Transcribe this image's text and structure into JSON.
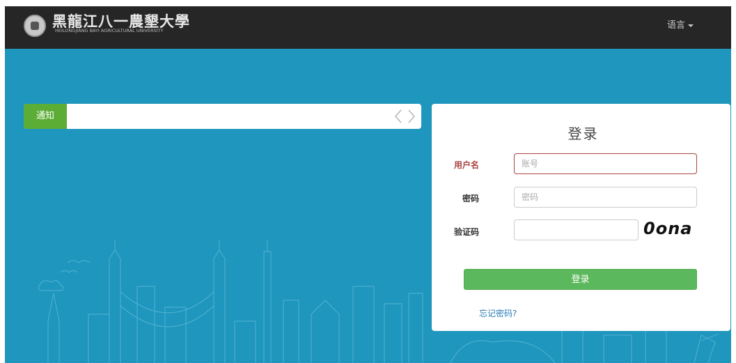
{
  "header": {
    "logo_cn": "黑龍江八一農墾大學",
    "logo_en": "HEILONGJIANG BAYI AGRICULTURAL UNIVERSITY",
    "lang_label": "语言"
  },
  "notice": {
    "tag_label": "通知",
    "prev_arrow": "‹",
    "next_arrow": "›"
  },
  "login": {
    "title": "登录",
    "username_label": "用户名",
    "username_placeholder": "账号",
    "password_label": "密码",
    "password_placeholder": "密码",
    "captcha_label": "验证码",
    "captcha_text": "0ona",
    "submit_label": "登录",
    "forgot_label": "忘记密码?"
  },
  "colors": {
    "background": "#1e96bd",
    "topbar": "#262626",
    "notice_tag": "#5cad36",
    "login_button": "#5cb85c",
    "error": "#a94442",
    "link": "#2a7ab3"
  }
}
